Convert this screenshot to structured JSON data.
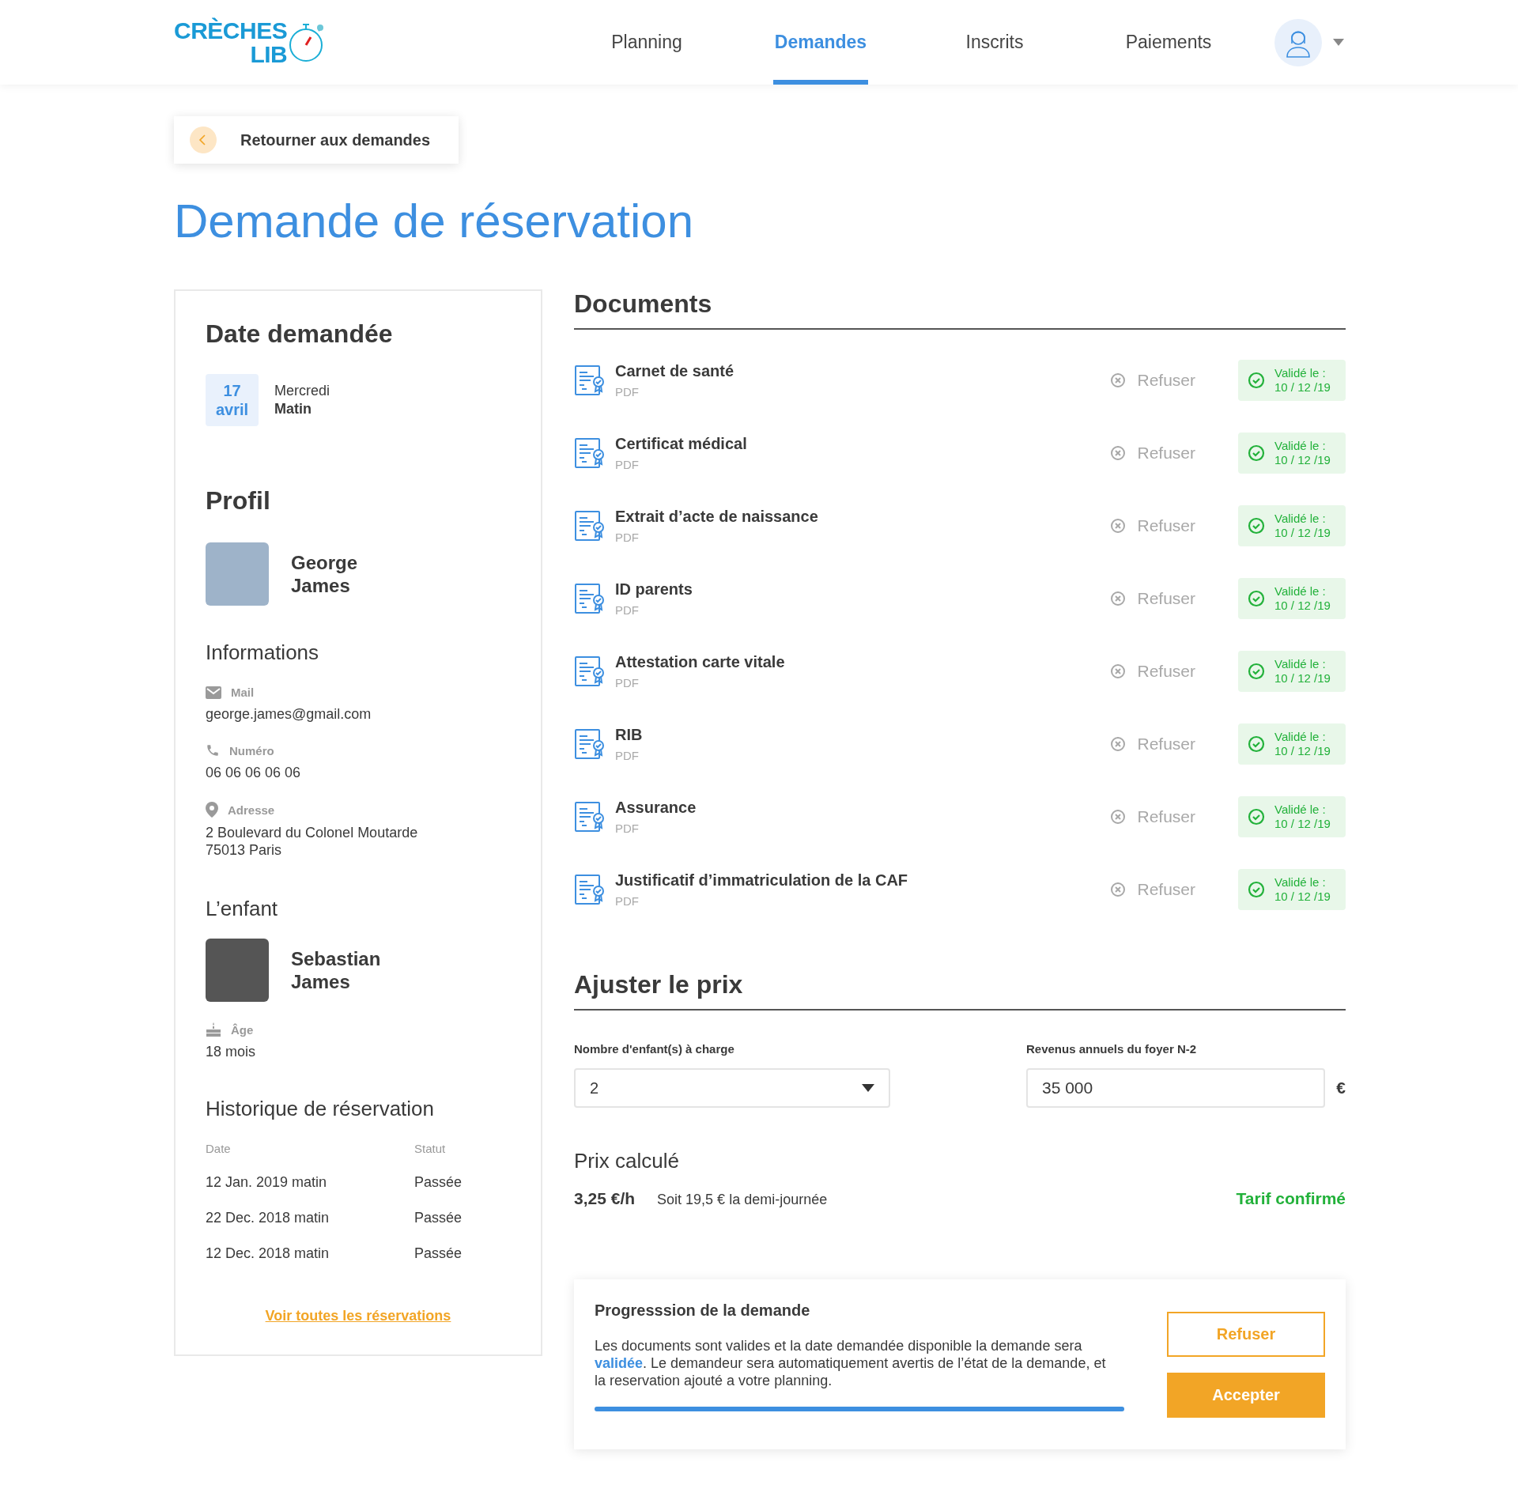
{
  "header": {
    "logo": {
      "line_1": "CRÈCHES",
      "line_2": "LIB"
    },
    "nav": [
      {
        "label": "Planning",
        "selected": false
      },
      {
        "label": "Demandes",
        "selected": true
      },
      {
        "label": "Inscrits",
        "selected": false
      },
      {
        "label": "Paiements",
        "selected": false
      }
    ]
  },
  "back_button": {
    "label": "Retourner aux demandes"
  },
  "title": "Demande de réservation",
  "sidebar": {
    "date_section": {
      "heading": "Date demandée",
      "day": "17",
      "month": "avril",
      "weekday": "Mercredi",
      "period": "Matin"
    },
    "profile": {
      "heading": "Profil",
      "first_name": "George",
      "last_name": "James"
    },
    "informations": {
      "heading": "Informations",
      "items": [
        {
          "kind": "mail",
          "label": "Mail",
          "lines": [
            "george.james@gmail.com"
          ]
        },
        {
          "kind": "phone",
          "label": "Numéro",
          "lines": [
            "06 06 06 06 06"
          ]
        },
        {
          "kind": "address",
          "label": "Adresse",
          "lines": [
            "2 Boulevard du Colonel Moutarde",
            "75013 Paris"
          ]
        }
      ]
    },
    "child": {
      "heading": "L’enfant",
      "first_name": "Sebastian",
      "last_name": "James",
      "age_label": "Âge",
      "age": "18 mois"
    },
    "history": {
      "heading": "Historique de réservation",
      "columns": [
        "Date",
        "Statut"
      ],
      "rows": [
        [
          "12 Jan. 2019 matin",
          "Passée"
        ],
        [
          "22 Dec. 2018 matin",
          "Passée"
        ],
        [
          "12 Dec. 2018 matin",
          "Passée"
        ]
      ],
      "link": "Voir toutes les réservations"
    }
  },
  "documents": {
    "heading": "Documents",
    "items": [
      {
        "name": "Carnet de santé",
        "type": "PDF",
        "refuse": "Refuser",
        "validated": true,
        "status_label": "Validé le :",
        "status_date": "10 / 12 /19"
      },
      {
        "name": "Certificat médical",
        "type": "PDF",
        "refuse": "Refuser",
        "validated": true,
        "status_label": "Validé le :",
        "status_date": "10 / 12 /19"
      },
      {
        "name": "Extrait d’acte de naissance",
        "type": "PDF",
        "refuse": "Refuser",
        "validated": true,
        "status_label": "Validé le :",
        "status_date": "10 / 12 /19"
      },
      {
        "name": "ID parents",
        "type": "PDF",
        "refuse": "Refuser",
        "validated": true,
        "status_label": "Validé le :",
        "status_date": "10 / 12 /19"
      },
      {
        "name": "Attestation carte vitale",
        "type": "PDF",
        "refuse": "Refuser",
        "validated": true,
        "status_label": "Validé le :",
        "status_date": "10 / 12 /19"
      },
      {
        "name": "RIB",
        "type": "PDF",
        "refuse": "Refuser",
        "validated": true,
        "status_label": "Validé le :",
        "status_date": "10 / 12 /19"
      },
      {
        "name": "Assurance",
        "type": "PDF",
        "refuse": "Refuser",
        "validated": true,
        "status_label": "Validé le :",
        "status_date": "10 / 12 /19"
      },
      {
        "name": "Justificatif d’immatriculation de la CAF",
        "type": "PDF",
        "refuse": "Refuser",
        "validated": true,
        "status_label": "Validé le :",
        "status_date": "10 / 12 /19"
      }
    ]
  },
  "price": {
    "heading": "Ajuster le prix",
    "children_field": {
      "label": "Nombre d'enfant(s) à charge",
      "value": "2"
    },
    "income_field": {
      "label": "Revenus annuels du foyer N-2",
      "value": "35 000",
      "unit": "€"
    },
    "computed_heading": "Prix calculé",
    "hourly": "3,25 €/h",
    "half_day": "Soit 19,5 € la demi-journée",
    "status": "Tarif confirmé"
  },
  "progress": {
    "heading": "Progresssion de la demande",
    "text": "Les documents sont valides et la date demandée disponible la demande sera **validée**. Le demandeur sera automatiquement avertis de l’état de la demande, et la reservation ajouté a votre planning.",
    "level": 1,
    "refuse": "Refuser",
    "accept": "Accepter"
  }
}
